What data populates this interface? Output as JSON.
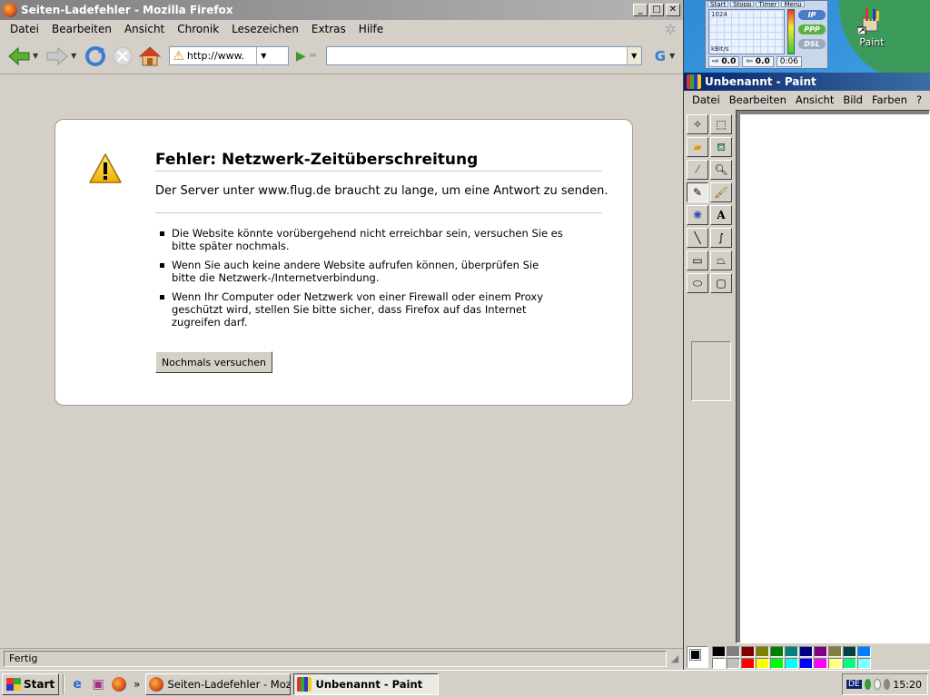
{
  "desktop": {
    "icon_label": "Paint"
  },
  "dsl_widget": {
    "tabs": [
      "Start",
      "Stopp",
      "Timer",
      "Menü"
    ],
    "scale_top": "1024",
    "scale_unit": "kBit/s",
    "pill_ip": "IP",
    "pill_ppp": "PPP",
    "pill_dsl": "DSL",
    "down": "0.0",
    "up": "0.0",
    "time": "0:06"
  },
  "firefox": {
    "title": "Seiten-Ladefehler - Mozilla Firefox",
    "menu": [
      "Datei",
      "Bearbeiten",
      "Ansicht",
      "Chronik",
      "Lesezeichen",
      "Extras",
      "Hilfe"
    ],
    "url": "http://www.",
    "search_placeholder": "",
    "error": {
      "title": "Fehler: Netzwerk-Zeitüberschreitung",
      "short": "Der Server unter www.flug.de braucht zu lange, um eine Antwort zu senden.",
      "items": [
        "Die Website könnte vorübergehend nicht erreichbar sein, versuchen Sie es bitte später nochmals.",
        "Wenn Sie auch keine andere Website aufrufen können, überprüfen Sie bitte die Netzwerk-/Internetverbindung.",
        "Wenn Ihr Computer oder Netzwerk von einer Firewall oder einem Proxy geschützt wird, stellen Sie bitte sicher, dass Firefox auf das Internet zugreifen darf."
      ],
      "retry_label": "Nochmals versuchen"
    },
    "status": "Fertig"
  },
  "paint": {
    "title": "Unbenannt - Paint",
    "menu": [
      "Datei",
      "Bearbeiten",
      "Ansicht",
      "Bild",
      "Farben",
      "?"
    ],
    "palette_top": [
      "#000000",
      "#808080",
      "#800000",
      "#808000",
      "#008000",
      "#008080",
      "#000080",
      "#800080",
      "#808040",
      "#004040",
      "#0080ff"
    ],
    "palette_bottom": [
      "#ffffff",
      "#c0c0c0",
      "#ff0000",
      "#ffff00",
      "#00ff00",
      "#00ffff",
      "#0000ff",
      "#ff00ff",
      "#ffff80",
      "#00ff80",
      "#80ffff"
    ]
  },
  "taskbar": {
    "start": "Start",
    "chevron": "»",
    "tasks": [
      "Seiten-Ladefehler - Mozill...",
      "Unbenannt - Paint"
    ],
    "lang": "DE",
    "clock": "15:20"
  }
}
